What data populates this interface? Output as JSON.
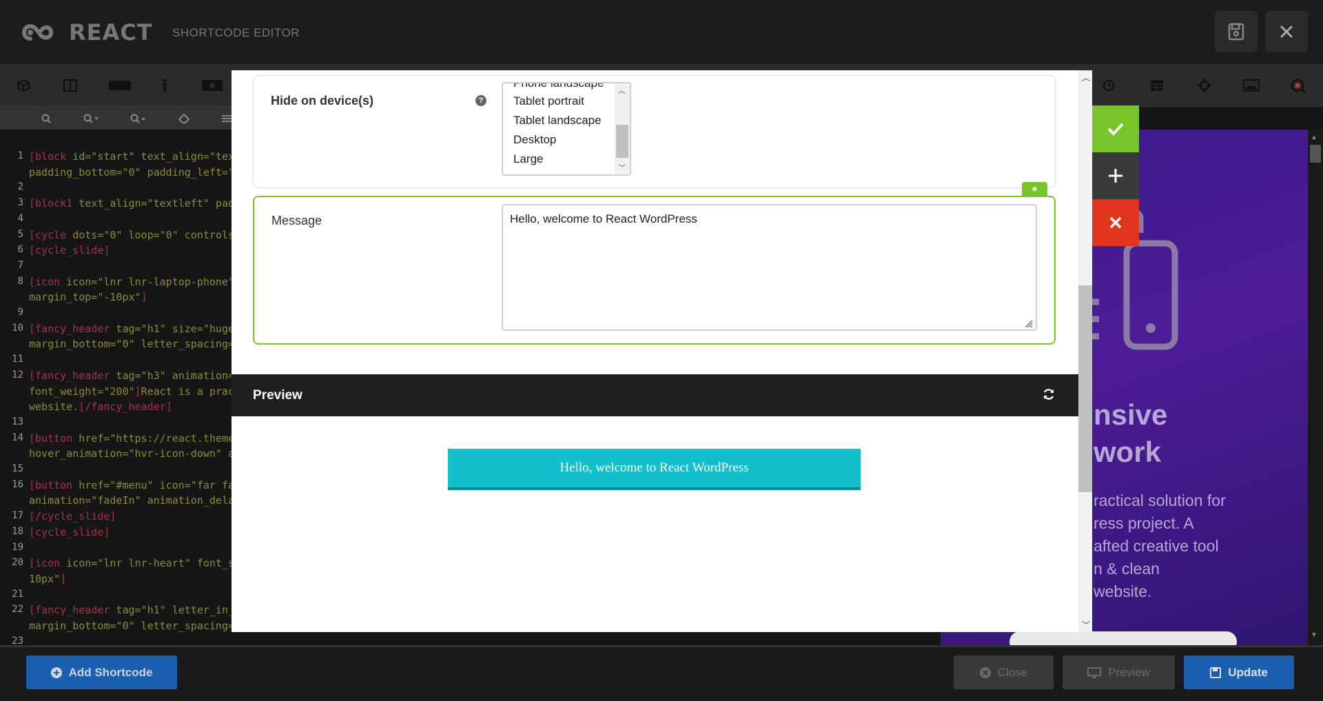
{
  "header": {
    "logo_text": "REACT",
    "subtitle": "SHORTCODE EDITOR"
  },
  "editor": {
    "lines": [
      {
        "n": "1",
        "code": "[block id=\"start\" text_align=\"tex"
      },
      {
        "n": "",
        "code": "padding_bottom=\"0\" padding_left=\""
      },
      {
        "n": "2",
        "code": ""
      },
      {
        "n": "3",
        "code": "[block1 text_align=\"textleft\" pad"
      },
      {
        "n": "4",
        "code": ""
      },
      {
        "n": "5",
        "code": "[cycle dots=\"0\" loop=\"0\" controls"
      },
      {
        "n": "6",
        "code": "[cycle_slide]"
      },
      {
        "n": "7",
        "code": ""
      },
      {
        "n": "8",
        "code": "[icon icon=\"lnr lnr-laptop-phone\""
      },
      {
        "n": "",
        "code": "margin_top=\"-10px\"]"
      },
      {
        "n": "9",
        "code": ""
      },
      {
        "n": "10",
        "code": "[fancy_header tag=\"h1\" size=\"huge"
      },
      {
        "n": "",
        "code": "margin_bottom=\"0\" letter_spacing="
      },
      {
        "n": "11",
        "code": ""
      },
      {
        "n": "12",
        "code": "[fancy_header tag=\"h3\" animation="
      },
      {
        "n": "",
        "code": "font_weight=\"200\"]React is a prac"
      },
      {
        "n": "",
        "code": "website.[/fancy_header]"
      },
      {
        "n": "13",
        "code": ""
      },
      {
        "n": "14",
        "code": "[button href=\"https://react.theme"
      },
      {
        "n": "",
        "code": "hover_animation=\"hvr-icon-down\" a"
      },
      {
        "n": "15",
        "code": ""
      },
      {
        "n": "16",
        "code": "[button href=\"#menu\" icon=\"far fa"
      },
      {
        "n": "",
        "code": "animation=\"fadeIn\" animation_dela"
      },
      {
        "n": "17",
        "code": "[/cycle_slide]"
      },
      {
        "n": "18",
        "code": "[cycle_slide]"
      },
      {
        "n": "19",
        "code": ""
      },
      {
        "n": "20",
        "code": "[icon icon=\"lnr lnr-heart\" font_s"
      },
      {
        "n": "",
        "code": "10px\"]"
      },
      {
        "n": "21",
        "code": ""
      },
      {
        "n": "22",
        "code": "[fancy_header tag=\"h1\" letter_in_"
      },
      {
        "n": "",
        "code": "margin_bottom=\"0\" letter_spacing="
      },
      {
        "n": "23",
        "code": ""
      }
    ]
  },
  "right_preview": {
    "heading_1": "nsive",
    "heading_2": "work",
    "body": [
      "ractical solution for",
      "ress project. A",
      "afted creative tool",
      "n & clean",
      "website."
    ]
  },
  "modal": {
    "hide_devices": {
      "label": "Hide on device(s)",
      "options": [
        "Phone landscape",
        "Tablet portrait",
        "Tablet landscape",
        "Desktop",
        "Large"
      ]
    },
    "message": {
      "label": "Message",
      "value": "Hello, welcome to React WordPress"
    },
    "preview": {
      "title": "Preview",
      "button_text": "Hello, welcome to React WordPress"
    }
  },
  "footer": {
    "add_shortcode": "Add Shortcode",
    "close": "Close",
    "preview": "Preview",
    "update": "Update"
  },
  "colors": {
    "accent_green": "#77c52a",
    "accent_red": "#e2351d",
    "accent_blue": "#1c5fb0",
    "preview_button": "#13bfcc"
  }
}
